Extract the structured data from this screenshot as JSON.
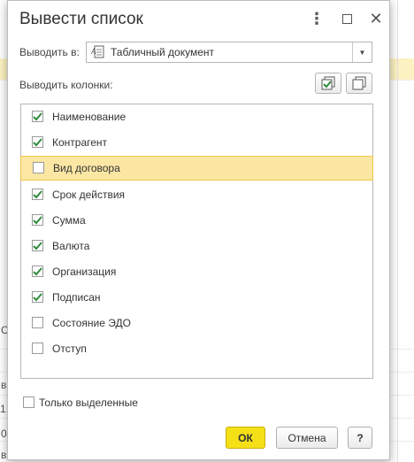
{
  "dialog": {
    "title": "Вывести список",
    "output_label": "Выводить в:",
    "output_value": "Табличный документ",
    "columns_label": "Выводить колонки:",
    "columns": [
      {
        "label": "Наименование",
        "checked": true
      },
      {
        "label": "Контрагент",
        "checked": true
      },
      {
        "label": "Вид договора",
        "checked": false,
        "selected": true
      },
      {
        "label": "Срок действия",
        "checked": true
      },
      {
        "label": "Сумма",
        "checked": true
      },
      {
        "label": "Валюта",
        "checked": true
      },
      {
        "label": "Организация",
        "checked": true
      },
      {
        "label": "Подписан",
        "checked": true
      },
      {
        "label": "Состояние ЭДО",
        "checked": false
      },
      {
        "label": "Отступ",
        "checked": false
      }
    ],
    "selected_only_label": "Только выделенные",
    "selected_only_checked": false,
    "ok_label": "ОК",
    "cancel_label": "Отмена",
    "help_label": "?"
  },
  "background_fragments": [
    "С",
    "в",
    "1.",
    "0",
    "в"
  ],
  "colors": {
    "accent_yellow": "#f5df17",
    "selected_row": "#fbe6a3",
    "checkmark_green": "#2e8b3a"
  }
}
